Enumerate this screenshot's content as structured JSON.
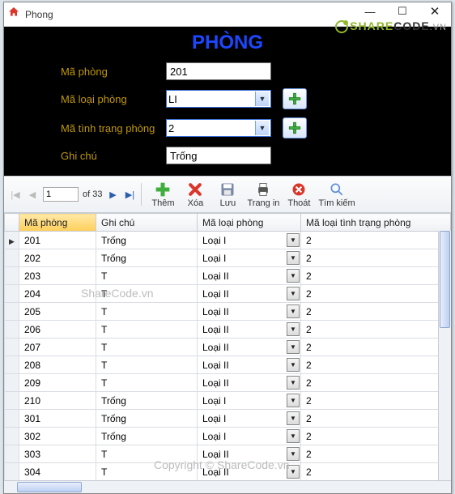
{
  "window": {
    "title": "Phong"
  },
  "brand": {
    "share": "SHARE",
    "code": "CODE",
    "tld": ".VN"
  },
  "form": {
    "title": "PHÒNG",
    "labels": {
      "maphong": "Mã phòng",
      "maloai": "Mã loại phòng",
      "matinhrang": "Mã tình trạng phòng",
      "ghichu": "Ghi chú"
    },
    "values": {
      "maphong": "201",
      "maloai": "LI",
      "matinhrang": "2",
      "ghichu": "Trống"
    }
  },
  "pager": {
    "current": "1",
    "of": "of 33"
  },
  "toolbar": {
    "them": "Thêm",
    "xoa": "Xóa",
    "luu": "Lưu",
    "trangin": "Trang in",
    "thoat": "Thoát",
    "timkiem": "Tìm kiếm"
  },
  "grid": {
    "headers": {
      "maphong": "Mã phòng",
      "ghichu": "Ghi chú",
      "maloai": "Mã loại phòng",
      "matinhrang": "Mã loại tình trạng phòng"
    },
    "rows": [
      {
        "maphong": "201",
        "ghichu": "Trống",
        "maloai": "Loại I",
        "matt": "2"
      },
      {
        "maphong": "202",
        "ghichu": "Trống",
        "maloai": "Loại I",
        "matt": "2"
      },
      {
        "maphong": "203",
        "ghichu": "T",
        "maloai": "Loại II",
        "matt": "2"
      },
      {
        "maphong": "204",
        "ghichu": "T",
        "maloai": "Loại II",
        "matt": "2"
      },
      {
        "maphong": "205",
        "ghichu": "T",
        "maloai": "Loại II",
        "matt": "2"
      },
      {
        "maphong": "206",
        "ghichu": "T",
        "maloai": "Loại II",
        "matt": "2"
      },
      {
        "maphong": "207",
        "ghichu": "T",
        "maloai": "Loại II",
        "matt": "2"
      },
      {
        "maphong": "208",
        "ghichu": "T",
        "maloai": "Loại II",
        "matt": "2"
      },
      {
        "maphong": "209",
        "ghichu": "T",
        "maloai": "Loại II",
        "matt": "2"
      },
      {
        "maphong": "210",
        "ghichu": "Trống",
        "maloai": "Loại I",
        "matt": "2"
      },
      {
        "maphong": "301",
        "ghichu": "Trống",
        "maloai": "Loại I",
        "matt": "2"
      },
      {
        "maphong": "302",
        "ghichu": "Trống",
        "maloai": "Loại I",
        "matt": "2"
      },
      {
        "maphong": "303",
        "ghichu": "T",
        "maloai": "Loại II",
        "matt": "2"
      },
      {
        "maphong": "304",
        "ghichu": "T",
        "maloai": "Loại II",
        "matt": "2"
      }
    ]
  },
  "watermarks": {
    "w1": "ShareCode.vn",
    "w2": "Copyright © ShareCode.vn"
  }
}
